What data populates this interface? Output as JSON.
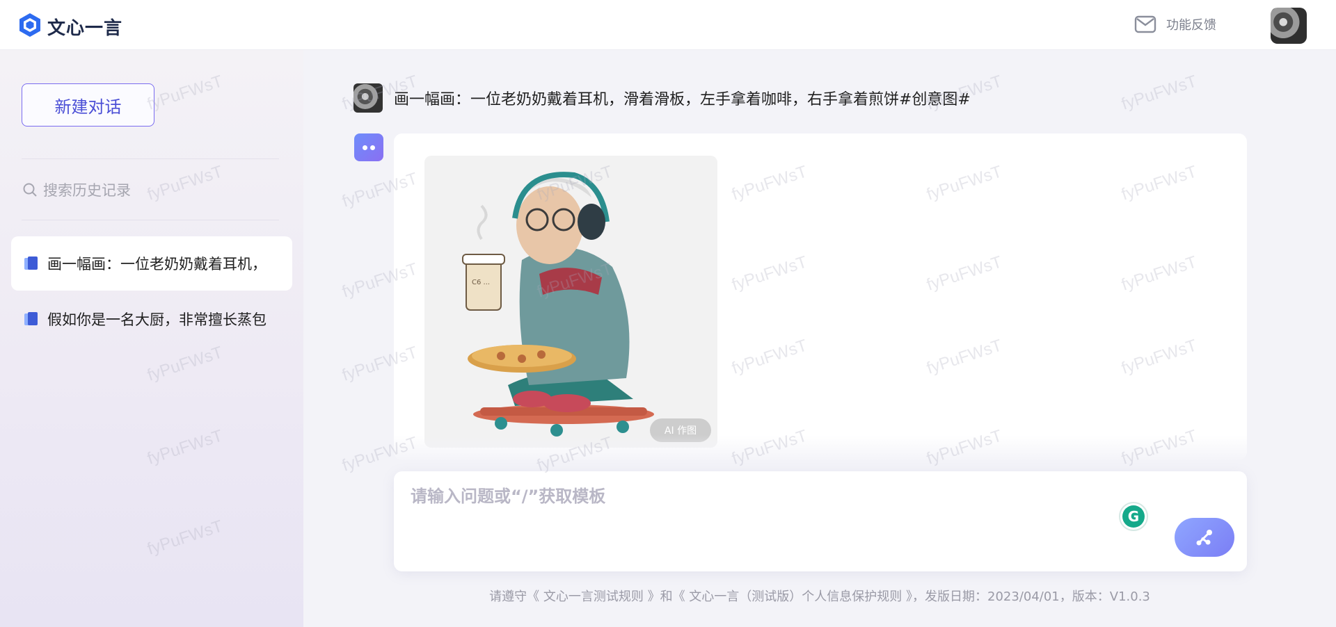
{
  "app": {
    "brand": "文心一言"
  },
  "header": {
    "feedback_label": "功能反馈"
  },
  "sidebar": {
    "new_chat_label": "新建对话",
    "search_placeholder": "搜索历史记录",
    "history": [
      {
        "label": "画一幅画：一位老奶奶戴着耳机，",
        "active": true
      },
      {
        "label": "假如你是一名大厨，非常擅长蒸包",
        "active": false
      }
    ]
  },
  "chat": {
    "user_message": "画一幅画：一位老奶奶戴着耳机，滑着滑板，左手拿着咖啡，右手拿着煎饼#创意图#",
    "ai_badge": "AI 作图",
    "cup_text": "C6 ..."
  },
  "input": {
    "placeholder": "请输入问题或“/”获取模板"
  },
  "footer": {
    "text": "请遵守《 文心一言测试规则 》和《 文心一言（测试版）个人信息保护规则 》，发版日期：2023/04/01，版本：V1.0.3"
  },
  "watermark": {
    "text": "fyPuFWsT"
  },
  "colors": {
    "accent": "#4b4fd6",
    "accent_border": "#7a6cf0",
    "send_gradient_start": "#8fa6ff",
    "send_gradient_end": "#7b7ef5",
    "grammarly": "#15a98a"
  }
}
